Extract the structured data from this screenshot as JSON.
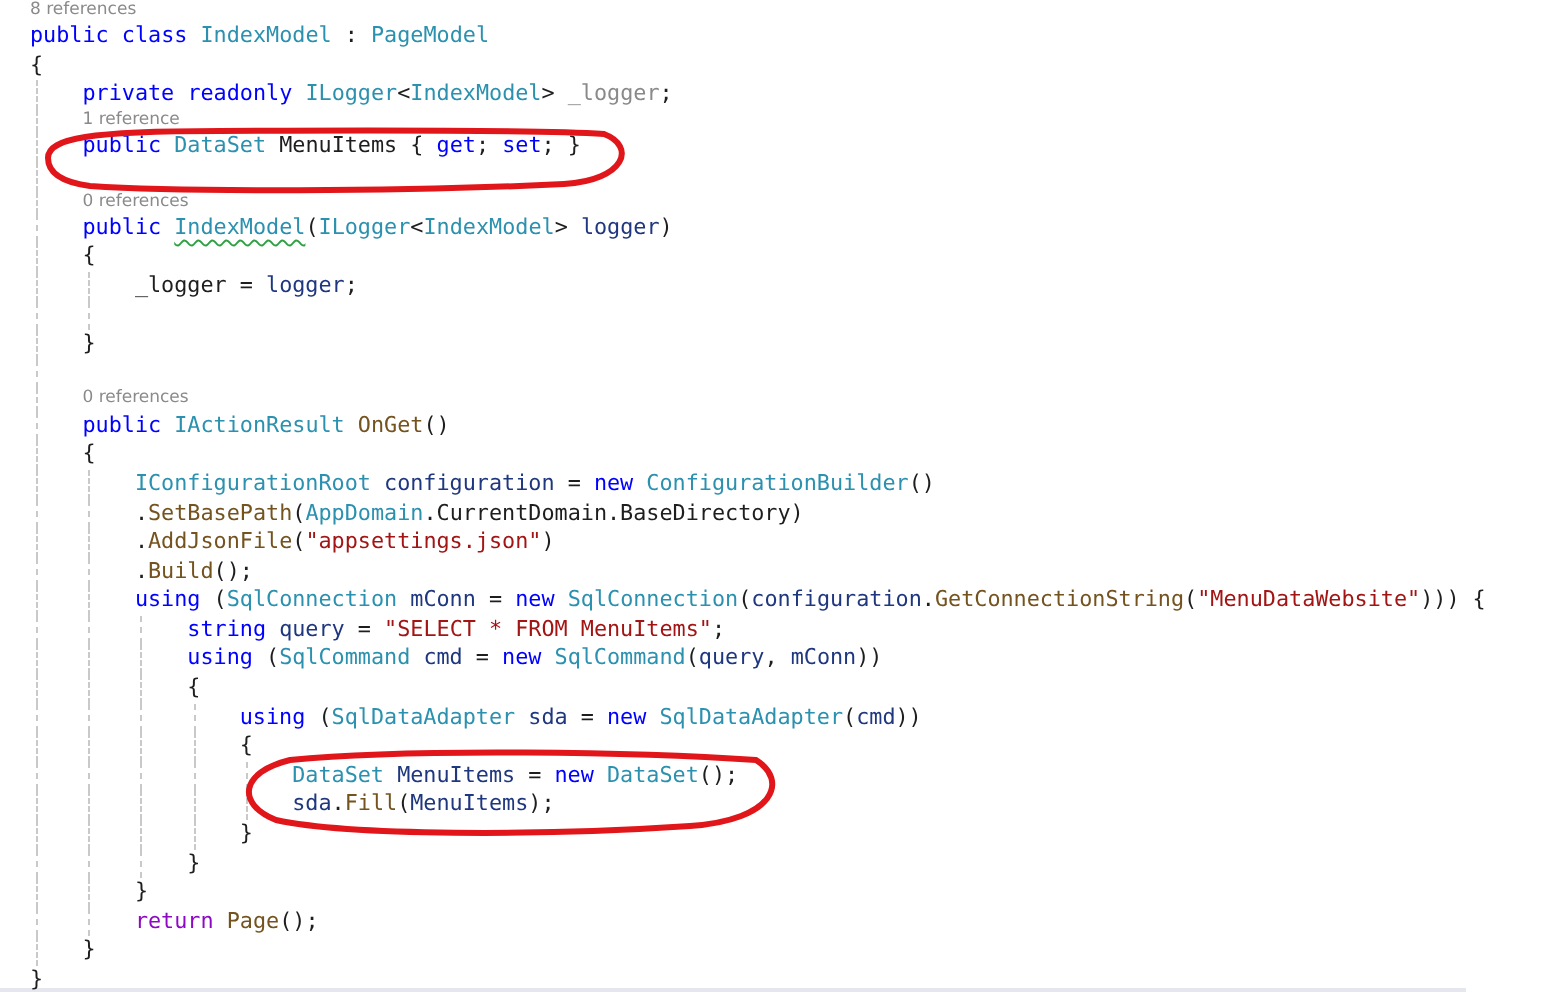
{
  "editor": {
    "lines": [
      {
        "kind": "lens",
        "text": "8 references"
      },
      {
        "kind": "code",
        "tokens": [
          {
            "kind": "keyword",
            "text": "public "
          },
          {
            "kind": "keyword",
            "text": "class "
          },
          {
            "kind": "type",
            "text": "IndexModel"
          },
          {
            "kind": "plain",
            "text": " : "
          },
          {
            "kind": "type",
            "text": "PageModel"
          }
        ]
      },
      {
        "kind": "code",
        "tokens": [
          {
            "kind": "plain",
            "text": "{"
          }
        ]
      },
      {
        "kind": "block",
        "children": [
          {
            "kind": "code",
            "tokens": [
              {
                "kind": "keyword",
                "text": "private "
              },
              {
                "kind": "keyword",
                "text": "readonly "
              },
              {
                "kind": "type",
                "text": "ILogger"
              },
              {
                "kind": "plain",
                "text": "<"
              },
              {
                "kind": "type",
                "text": "IndexModel"
              },
              {
                "kind": "plain",
                "text": "> "
              },
              {
                "kind": "faded",
                "text": "_logger"
              },
              {
                "kind": "plain",
                "text": ";"
              }
            ]
          },
          {
            "kind": "lens",
            "text": "1 reference"
          },
          {
            "kind": "code",
            "tokens": [
              {
                "kind": "keyword",
                "text": "public "
              },
              {
                "kind": "type",
                "text": "DataSet"
              },
              {
                "kind": "plain",
                "text": " MenuItems { "
              },
              {
                "kind": "keyword",
                "text": "get"
              },
              {
                "kind": "plain",
                "text": "; "
              },
              {
                "kind": "keyword",
                "text": "set"
              },
              {
                "kind": "plain",
                "text": "; }"
              }
            ]
          },
          {
            "kind": "blank"
          },
          {
            "kind": "lens",
            "text": "0 references"
          },
          {
            "kind": "code",
            "tokens": [
              {
                "kind": "keyword",
                "text": "public "
              },
              {
                "kind": "type",
                "text": "IndexModel",
                "squiggle": true
              },
              {
                "kind": "plain",
                "text": "("
              },
              {
                "kind": "type",
                "text": "ILogger"
              },
              {
                "kind": "plain",
                "text": "<"
              },
              {
                "kind": "type",
                "text": "IndexModel"
              },
              {
                "kind": "plain",
                "text": "> "
              },
              {
                "kind": "variable",
                "text": "logger"
              },
              {
                "kind": "plain",
                "text": ")"
              }
            ]
          },
          {
            "kind": "code",
            "tokens": [
              {
                "kind": "plain",
                "text": "{"
              }
            ]
          },
          {
            "kind": "block",
            "children": [
              {
                "kind": "code",
                "tokens": [
                  {
                    "kind": "plain",
                    "text": "_logger = "
                  },
                  {
                    "kind": "variable",
                    "text": "logger"
                  },
                  {
                    "kind": "plain",
                    "text": ";"
                  }
                ]
              },
              {
                "kind": "blank"
              }
            ]
          },
          {
            "kind": "code",
            "tokens": [
              {
                "kind": "plain",
                "text": "}"
              }
            ]
          },
          {
            "kind": "blank"
          },
          {
            "kind": "lens",
            "text": "0 references"
          },
          {
            "kind": "code",
            "tokens": [
              {
                "kind": "keyword",
                "text": "public "
              },
              {
                "kind": "type",
                "text": "IActionResult "
              },
              {
                "kind": "method",
                "text": "OnGet"
              },
              {
                "kind": "plain",
                "text": "()"
              }
            ]
          },
          {
            "kind": "code",
            "tokens": [
              {
                "kind": "plain",
                "text": "{"
              }
            ]
          },
          {
            "kind": "block",
            "children": [
              {
                "kind": "code",
                "tokens": [
                  {
                    "kind": "type",
                    "text": "IConfigurationRoot "
                  },
                  {
                    "kind": "variable",
                    "text": "configuration"
                  },
                  {
                    "kind": "plain",
                    "text": " = "
                  },
                  {
                    "kind": "keyword",
                    "text": "new "
                  },
                  {
                    "kind": "type",
                    "text": "ConfigurationBuilder"
                  },
                  {
                    "kind": "plain",
                    "text": "()"
                  }
                ]
              },
              {
                "kind": "code",
                "tokens": [
                  {
                    "kind": "plain",
                    "text": "."
                  },
                  {
                    "kind": "method",
                    "text": "SetBasePath"
                  },
                  {
                    "kind": "plain",
                    "text": "("
                  },
                  {
                    "kind": "type",
                    "text": "AppDomain"
                  },
                  {
                    "kind": "plain",
                    "text": ".CurrentDomain.BaseDirectory)"
                  }
                ]
              },
              {
                "kind": "code",
                "tokens": [
                  {
                    "kind": "plain",
                    "text": "."
                  },
                  {
                    "kind": "method",
                    "text": "AddJsonFile"
                  },
                  {
                    "kind": "plain",
                    "text": "("
                  },
                  {
                    "kind": "string",
                    "text": "\"appsettings.json\""
                  },
                  {
                    "kind": "plain",
                    "text": ")"
                  }
                ]
              },
              {
                "kind": "code",
                "tokens": [
                  {
                    "kind": "plain",
                    "text": "."
                  },
                  {
                    "kind": "method",
                    "text": "Build"
                  },
                  {
                    "kind": "plain",
                    "text": "();"
                  }
                ]
              },
              {
                "kind": "code",
                "tokens": [
                  {
                    "kind": "keyword",
                    "text": "using "
                  },
                  {
                    "kind": "plain",
                    "text": "("
                  },
                  {
                    "kind": "type",
                    "text": "SqlConnection "
                  },
                  {
                    "kind": "variable",
                    "text": "mConn"
                  },
                  {
                    "kind": "plain",
                    "text": " = "
                  },
                  {
                    "kind": "keyword",
                    "text": "new "
                  },
                  {
                    "kind": "type",
                    "text": "SqlConnection"
                  },
                  {
                    "kind": "plain",
                    "text": "("
                  },
                  {
                    "kind": "variable",
                    "text": "configuration"
                  },
                  {
                    "kind": "plain",
                    "text": "."
                  },
                  {
                    "kind": "method",
                    "text": "GetConnectionString"
                  },
                  {
                    "kind": "plain",
                    "text": "("
                  },
                  {
                    "kind": "string",
                    "text": "\"MenuDataWebsite\""
                  },
                  {
                    "kind": "plain",
                    "text": "))) {"
                  }
                ]
              },
              {
                "kind": "block",
                "children": [
                  {
                    "kind": "code",
                    "tokens": [
                      {
                        "kind": "keyword",
                        "text": "string "
                      },
                      {
                        "kind": "variable",
                        "text": "query"
                      },
                      {
                        "kind": "plain",
                        "text": " = "
                      },
                      {
                        "kind": "string",
                        "text": "\"SELECT * FROM MenuItems\""
                      },
                      {
                        "kind": "plain",
                        "text": ";"
                      }
                    ]
                  },
                  {
                    "kind": "code",
                    "tokens": [
                      {
                        "kind": "keyword",
                        "text": "using "
                      },
                      {
                        "kind": "plain",
                        "text": "("
                      },
                      {
                        "kind": "type",
                        "text": "SqlCommand "
                      },
                      {
                        "kind": "variable",
                        "text": "cmd"
                      },
                      {
                        "kind": "plain",
                        "text": " = "
                      },
                      {
                        "kind": "keyword",
                        "text": "new "
                      },
                      {
                        "kind": "type",
                        "text": "SqlCommand"
                      },
                      {
                        "kind": "plain",
                        "text": "("
                      },
                      {
                        "kind": "variable",
                        "text": "query"
                      },
                      {
                        "kind": "plain",
                        "text": ", "
                      },
                      {
                        "kind": "variable",
                        "text": "mConn"
                      },
                      {
                        "kind": "plain",
                        "text": "))"
                      }
                    ]
                  },
                  {
                    "kind": "code",
                    "tokens": [
                      {
                        "kind": "plain",
                        "text": "{"
                      }
                    ]
                  },
                  {
                    "kind": "block",
                    "children": [
                      {
                        "kind": "code",
                        "tokens": [
                          {
                            "kind": "keyword",
                            "text": "using "
                          },
                          {
                            "kind": "plain",
                            "text": "("
                          },
                          {
                            "kind": "type",
                            "text": "SqlDataAdapter "
                          },
                          {
                            "kind": "variable",
                            "text": "sda"
                          },
                          {
                            "kind": "plain",
                            "text": " = "
                          },
                          {
                            "kind": "keyword",
                            "text": "new "
                          },
                          {
                            "kind": "type",
                            "text": "SqlDataAdapter"
                          },
                          {
                            "kind": "plain",
                            "text": "("
                          },
                          {
                            "kind": "variable",
                            "text": "cmd"
                          },
                          {
                            "kind": "plain",
                            "text": "))"
                          }
                        ]
                      },
                      {
                        "kind": "code",
                        "tokens": [
                          {
                            "kind": "plain",
                            "text": "{"
                          }
                        ]
                      },
                      {
                        "kind": "block",
                        "children": [
                          {
                            "kind": "code",
                            "tokens": [
                              {
                                "kind": "type",
                                "text": "DataSet "
                              },
                              {
                                "kind": "variable",
                                "text": "MenuItems"
                              },
                              {
                                "kind": "plain",
                                "text": " = "
                              },
                              {
                                "kind": "keyword",
                                "text": "new "
                              },
                              {
                                "kind": "type",
                                "text": "DataSet"
                              },
                              {
                                "kind": "plain",
                                "text": "();"
                              }
                            ]
                          },
                          {
                            "kind": "code",
                            "tokens": [
                              {
                                "kind": "variable",
                                "text": "sda"
                              },
                              {
                                "kind": "plain",
                                "text": "."
                              },
                              {
                                "kind": "method",
                                "text": "Fill"
                              },
                              {
                                "kind": "plain",
                                "text": "("
                              },
                              {
                                "kind": "variable",
                                "text": "MenuItems"
                              },
                              {
                                "kind": "plain",
                                "text": ");"
                              }
                            ]
                          }
                        ]
                      },
                      {
                        "kind": "code",
                        "tokens": [
                          {
                            "kind": "plain",
                            "text": "}"
                          }
                        ]
                      }
                    ]
                  },
                  {
                    "kind": "code",
                    "tokens": [
                      {
                        "kind": "plain",
                        "text": "}"
                      }
                    ]
                  }
                ]
              },
              {
                "kind": "code",
                "tokens": [
                  {
                    "kind": "plain",
                    "text": "}"
                  }
                ]
              },
              {
                "kind": "code",
                "tokens": [
                  {
                    "kind": "control",
                    "text": "return "
                  },
                  {
                    "kind": "method",
                    "text": "Page"
                  },
                  {
                    "kind": "plain",
                    "text": "();"
                  }
                ]
              }
            ]
          },
          {
            "kind": "code",
            "tokens": [
              {
                "kind": "plain",
                "text": "}"
              }
            ]
          }
        ]
      },
      {
        "kind": "code",
        "tokens": [
          {
            "kind": "plain",
            "text": "}"
          }
        ]
      }
    ]
  }
}
